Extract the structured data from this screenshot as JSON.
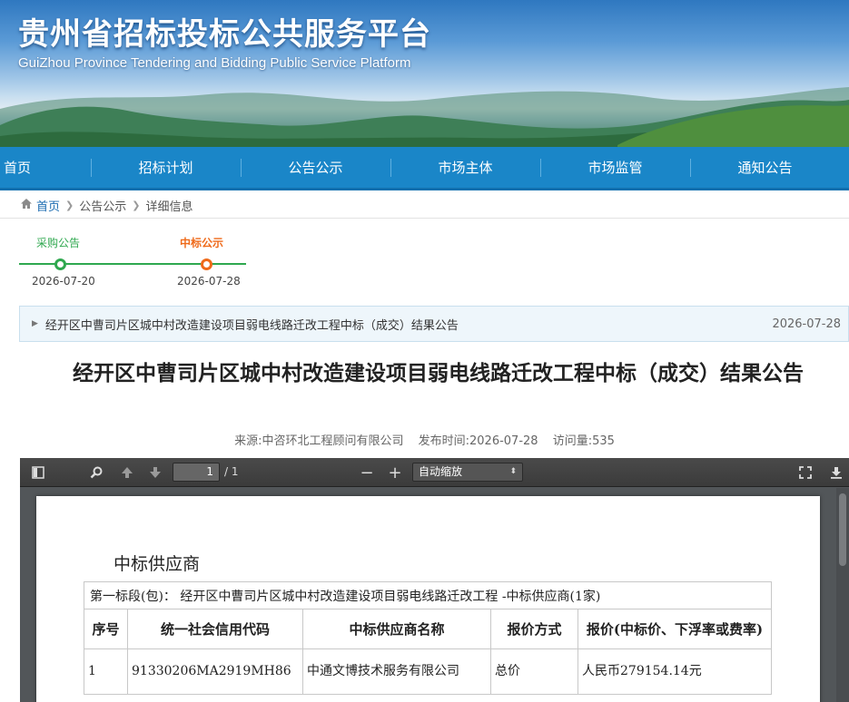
{
  "site": {
    "title": "贵州省招标投标公共服务平台",
    "subtitle": "GuiZhou Province Tendering and Bidding Public Service Platform"
  },
  "nav": {
    "items": [
      "首页",
      "招标计划",
      "公告公示",
      "市场主体",
      "市场监管",
      "通知公告"
    ]
  },
  "breadcrumb": {
    "home": "首页",
    "items": [
      "公告公示",
      "详细信息"
    ]
  },
  "timeline": {
    "steps": [
      {
        "label": "采购公告",
        "date": "2026-07-20",
        "color": "#2fa84f"
      },
      {
        "label": "中标公示",
        "date": "2026-07-28",
        "color": "#ef6a1a"
      }
    ]
  },
  "notice": {
    "text": "经开区中曹司片区城中村改造建设项目弱电线路迁改工程中标（成交）结果公告",
    "date": "2026-07-28"
  },
  "article": {
    "title": "经开区中曹司片区城中村改造建设项目弱电线路迁改工程中标（成交）结果公告",
    "source": "来源:中咨环北工程顾问有限公司",
    "publish_time": "发布时间:2026-07-28",
    "views": "访问量:535"
  },
  "pdf_viewer": {
    "page_current": "1",
    "page_total": "/ 1",
    "zoom": "自动缩放",
    "icons": [
      "sidebar-toggle-icon",
      "search-icon",
      "arrow-up-icon",
      "arrow-down-icon",
      "zoom-out-icon",
      "zoom-in-icon",
      "fullscreen-icon",
      "download-icon"
    ],
    "page": {
      "heading": "中标供应商",
      "section": "第一标段(包)：  经开区中曹司片区城中村改造建设项目弱电线路迁改工程 -中标供应商(1家)",
      "columns": [
        "序号",
        "统一社会信用代码",
        "中标供应商名称",
        "报价方式",
        "报价(中标价、下浮率或费率)"
      ],
      "rows": [
        [
          "1",
          "91330206MA2919MH86",
          "中通文博技术服务有限公司",
          "总价",
          "人民币279154.14元"
        ]
      ]
    }
  },
  "colors": {
    "nav": "#1a86c8",
    "accent_green": "#2fa84f",
    "accent_orange": "#ef6a1a"
  }
}
